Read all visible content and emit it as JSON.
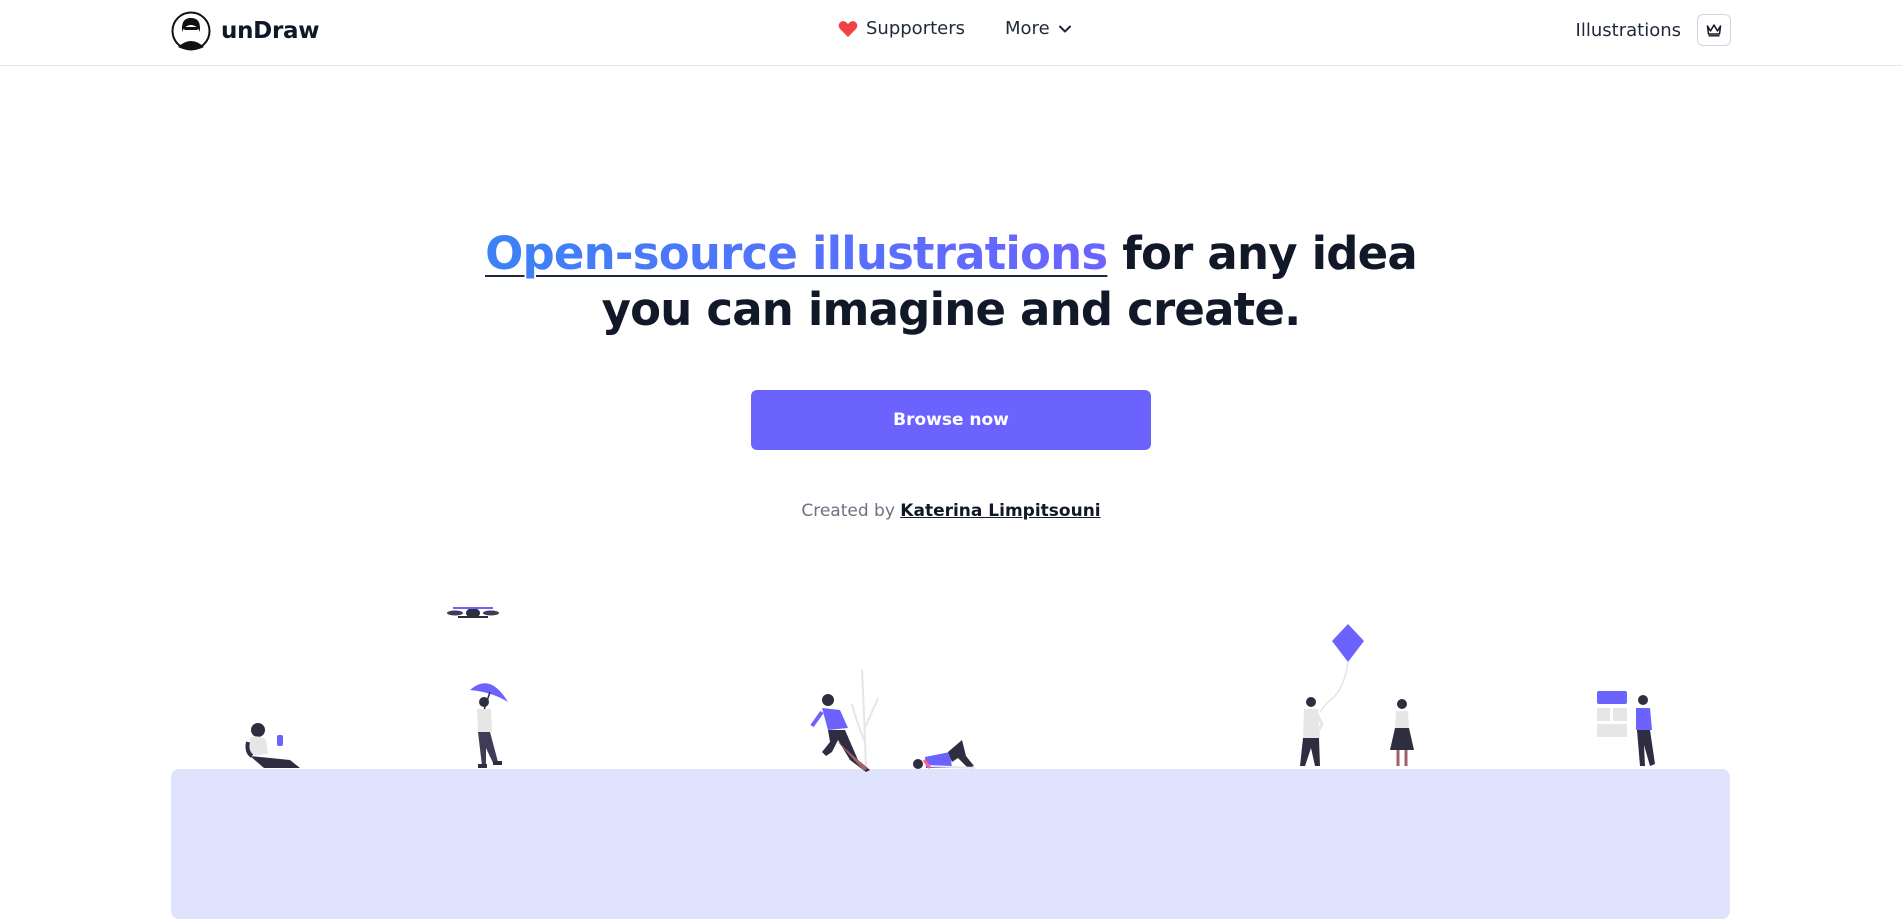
{
  "header": {
    "brand": "unDraw",
    "nav": {
      "supporters_label": "Supporters",
      "more_label": "More"
    },
    "right": {
      "illustrations_label": "Illustrations"
    }
  },
  "hero": {
    "title_accent": "Open-source illustrations",
    "title_rest": " for any idea you can imagine and create.",
    "cta_label": "Browse now",
    "credit_prefix": "Created by ",
    "credit_name": "Katerina Limpitsouni"
  },
  "colors": {
    "accent": "#6c63ff",
    "gradient_start": "#3b82f6",
    "ground": "#e0e3fd",
    "heart": "#ef4444"
  },
  "icons": [
    "logo-avatar-icon",
    "heart-icon",
    "chevron-down-icon",
    "crown-icon"
  ]
}
